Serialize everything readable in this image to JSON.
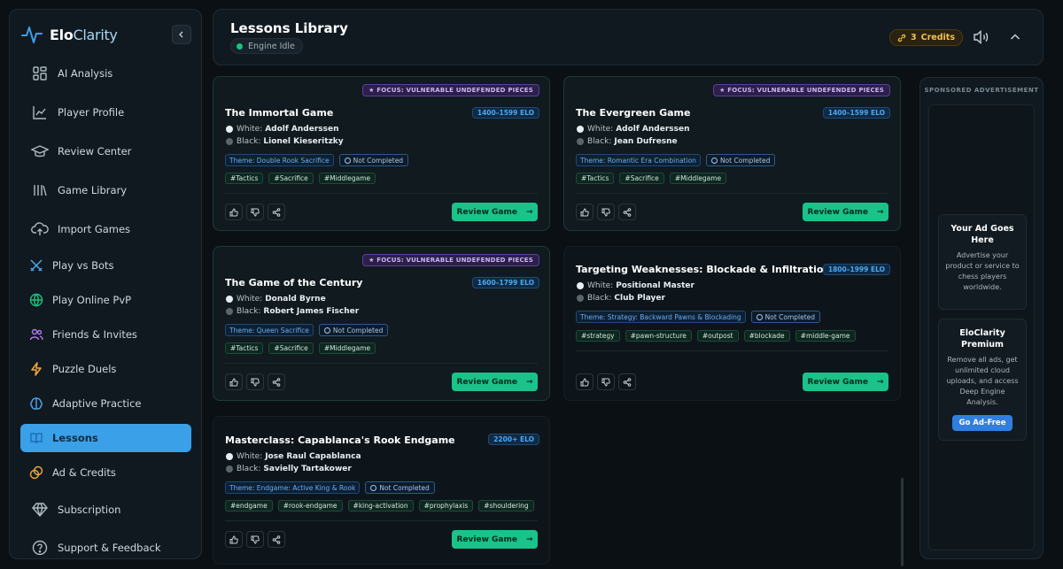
{
  "app": {
    "name_part1": "Elo",
    "name_part2": "Clarity"
  },
  "nav": [
    {
      "label": "AI Analysis",
      "icon": "grid-icon"
    },
    {
      "label": "Player Profile",
      "icon": "chart-line-icon"
    },
    {
      "label": "Review Center",
      "icon": "graduation-cap-icon"
    },
    {
      "label": "Game Library",
      "icon": "library-icon"
    },
    {
      "label": "Import Games",
      "icon": "cloud-upload-icon"
    },
    {
      "label": "Play vs Bots",
      "icon": "swords-icon"
    },
    {
      "label": "Play Online PvP",
      "icon": "globe-icon"
    },
    {
      "label": "Friends & Invites",
      "icon": "users-icon"
    },
    {
      "label": "Puzzle Duels",
      "icon": "bolt-icon"
    },
    {
      "label": "Adaptive Practice",
      "icon": "brain-icon"
    },
    {
      "label": "Lessons",
      "icon": "book-icon",
      "active": true
    },
    {
      "label": "Ad & Credits",
      "icon": "coins-icon"
    },
    {
      "label": "Subscription",
      "icon": "diamond-icon"
    },
    {
      "label": "Support & Feedback",
      "icon": "help-icon"
    }
  ],
  "header": {
    "title": "Lessons Library",
    "status": "Engine Idle",
    "credits_count": "3",
    "credits_label": "Credits"
  },
  "common": {
    "focus_label": "★ FOCUS: VULNERABLE UNDEFENDED PIECES",
    "review_label": "Review Game",
    "not_completed": "Not Completed",
    "white_prefix": "White:",
    "black_prefix": "Black:"
  },
  "lessons": [
    {
      "title": "The Immortal Game",
      "elo": "1400–1599 ELO",
      "white": "Adolf Anderssen",
      "black": "Lionel Kieseritzky",
      "theme": "Theme: Double Rook Sacrifice",
      "tags": [
        "#Tactics",
        "#Sacrifice",
        "#Middlegame"
      ],
      "focus": true
    },
    {
      "title": "The Evergreen Game",
      "elo": "1400–1599 ELO",
      "white": "Adolf Anderssen",
      "black": "Jean Dufresne",
      "theme": "Theme: Romantic Era Combination",
      "tags": [
        "#Tactics",
        "#Sacrifice",
        "#Middlegame"
      ],
      "focus": true
    },
    {
      "title": "The Game of the Century",
      "elo": "1600–1799 ELO",
      "white": "Donald Byrne",
      "black": "Robert James Fischer",
      "theme": "Theme: Queen Sacrifice",
      "tags": [
        "#Tactics",
        "#Sacrifice",
        "#Middlegame"
      ],
      "focus": true
    },
    {
      "title": "Targeting Weaknesses: Blockade & Infiltration",
      "elo": "1800–1999 ELO",
      "white": "Positional Master",
      "black": "Club Player",
      "theme": "Theme: Strategy: Backward Pawns & Blockading",
      "tags": [
        "#strategy",
        "#pawn-structure",
        "#outpost",
        "#blockade",
        "#middle-game"
      ],
      "focus": false
    },
    {
      "title": "Masterclass: Capablanca's Rook Endgame",
      "elo": "2200+ ELO",
      "white": "Jose Raul Capablanca",
      "black": "Savielly Tartakower",
      "theme": "Theme: Endgame: Active King & Rook",
      "tags": [
        "#endgame",
        "#rook-endgame",
        "#king-activation",
        "#prophylaxis",
        "#shouldering"
      ],
      "focus": false
    }
  ],
  "ads": {
    "label": "SPONSORED ADVERTISEMENT",
    "box1_title": "Your Ad Goes Here",
    "box1_desc": "Advertise your product or service to chess players worldwide.",
    "box2_title": "EloClarity Premium",
    "box2_desc": "Remove all ads, get unlimited cloud uploads, and access Deep Engine Analysis.",
    "box2_button": "Go Ad-Free"
  },
  "colors": {
    "accent": "#3aa0e8",
    "success": "#19c38a",
    "focus": "#c8b4f5",
    "elo": "#4da8f0",
    "credits": "#f2c14e"
  }
}
